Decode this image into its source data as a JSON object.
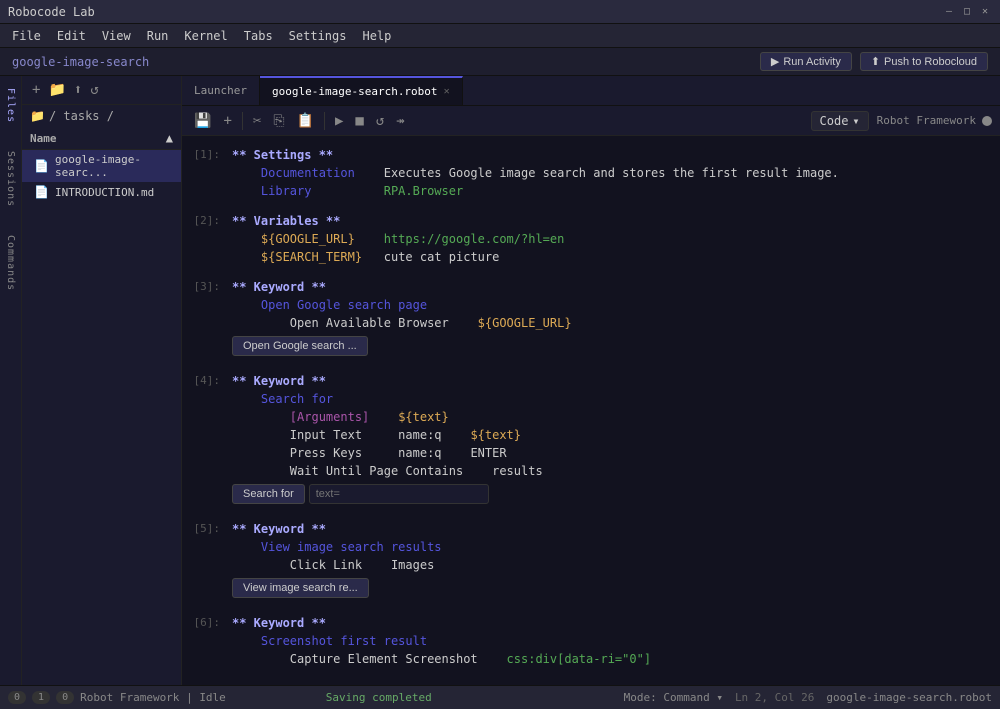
{
  "app": {
    "title": "Robocode Lab"
  },
  "window_controls": {
    "minimize": "—",
    "maximize": "□",
    "close": "✕"
  },
  "menubar": {
    "items": [
      "File",
      "Edit",
      "View",
      "Run",
      "Kernel",
      "Tabs",
      "Settings",
      "Help"
    ]
  },
  "subheader": {
    "project": "google-image-search"
  },
  "header_buttons": {
    "run_activity": "Run Activity",
    "push": "Push to Robocloud"
  },
  "tabs": {
    "launcher": "Launcher",
    "editor": "google-image-search.robot"
  },
  "toolbar": {
    "save_icon": "💾",
    "add_icon": "+",
    "cut_icon": "✂",
    "copy_icon": "⎘",
    "paste_icon": "📋",
    "play_icon": "▶",
    "stop_icon": "■",
    "refresh_icon": "↺",
    "skip_icon": "↠",
    "code_mode": "Code",
    "rf_label": "Robot Framework"
  },
  "file_panel": {
    "folder": "/ tasks /",
    "name_col": "Name",
    "files": [
      {
        "name": "google-image-searc...",
        "type": "robot"
      },
      {
        "name": "INTRODUCTION.md",
        "type": "md"
      }
    ]
  },
  "sidebar_labels": [
    "Files",
    "Sessions",
    "Commands"
  ],
  "code": {
    "blocks": [
      {
        "num": "[1]:",
        "lines": [
          {
            "text": "** Settings **",
            "type": "section"
          },
          {
            "text": "    Documentation    Executes Google image search and stores the first result image.",
            "type": "doc"
          },
          {
            "text": "    Library          RPA.Browser",
            "type": "lib"
          }
        ]
      },
      {
        "num": "[2]:",
        "lines": [
          {
            "text": "** Variables **",
            "type": "section"
          },
          {
            "text": "    ${GOOGLE_URL}    https://google.com/?hl=en",
            "type": "var"
          },
          {
            "text": "    ${SEARCH_TERM}   cute cat picture",
            "type": "var2"
          }
        ]
      },
      {
        "num": "[3]:",
        "lines": [
          {
            "text": "** Keyword **",
            "type": "section"
          },
          {
            "text": "    Open Google search page",
            "type": "keyword-name"
          },
          {
            "text": "        Open Available Browser    ${GOOGLE_URL}",
            "type": "stmt"
          }
        ],
        "button": "Open Google search ..."
      },
      {
        "num": "[4]:",
        "lines": [
          {
            "text": "** Keyword **",
            "type": "section"
          },
          {
            "text": "    Search for",
            "type": "keyword-name"
          },
          {
            "text": "        [Arguments]    ${text}",
            "type": "arg"
          },
          {
            "text": "        Input Text     name:q    ${text}",
            "type": "stmt"
          },
          {
            "text": "        Press Keys     name:q    ENTER",
            "type": "stmt2"
          },
          {
            "text": "        Wait Until Page Contains    results",
            "type": "stmt3"
          }
        ],
        "button": "Search for",
        "input_placeholder": "text="
      },
      {
        "num": "[5]:",
        "lines": [
          {
            "text": "** Keyword **",
            "type": "section"
          },
          {
            "text": "    View image search results",
            "type": "keyword-name"
          },
          {
            "text": "        Click Link    Images",
            "type": "stmt"
          }
        ],
        "button": "View image search re..."
      },
      {
        "num": "[6]:",
        "lines": [
          {
            "text": "** Keyword **",
            "type": "section"
          },
          {
            "text": "    Screenshot first result",
            "type": "keyword-name"
          },
          {
            "text": "        Capture Element Screenshot    css:div[data-ri=\"0\"]",
            "type": "stmt"
          }
        ]
      }
    ]
  },
  "statusbar": {
    "indicator1": "0",
    "indicator2": "1",
    "indicator3": "0",
    "rf_label": "Robot Framework",
    "rf_status": "Idle",
    "save_status": "Saving completed",
    "mode": "Mode: Command",
    "cursor": "Ln 2, Col 26",
    "filename": "google-image-search.robot"
  }
}
